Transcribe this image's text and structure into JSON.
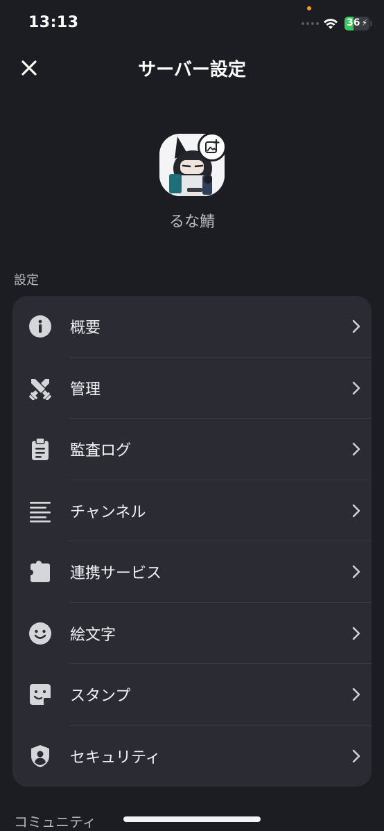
{
  "status_bar": {
    "time": "13:13",
    "battery": "36",
    "battery_level": 0.36
  },
  "header": {
    "title": "サーバー設定"
  },
  "server": {
    "name": "るな鯖"
  },
  "sections": [
    {
      "label": "設定",
      "items": [
        {
          "label": "概要",
          "icon": "info-icon"
        },
        {
          "label": "管理",
          "icon": "crossed-swords-icon"
        },
        {
          "label": "監査ログ",
          "icon": "clipboard-icon"
        },
        {
          "label": "チャンネル",
          "icon": "text-lines-icon"
        },
        {
          "label": "連携サービス",
          "icon": "puzzle-icon"
        },
        {
          "label": "絵文字",
          "icon": "smile-icon"
        },
        {
          "label": "スタンプ",
          "icon": "sticker-icon"
        },
        {
          "label": "セキュリティ",
          "icon": "shield-user-icon"
        }
      ]
    },
    {
      "label": "コミュニティ"
    }
  ],
  "colors": {
    "background": "#1c1d22",
    "card": "#2b2c33",
    "text": "#f2f3f5",
    "muted": "#b5b7bd",
    "battery_green": "#34c759"
  }
}
